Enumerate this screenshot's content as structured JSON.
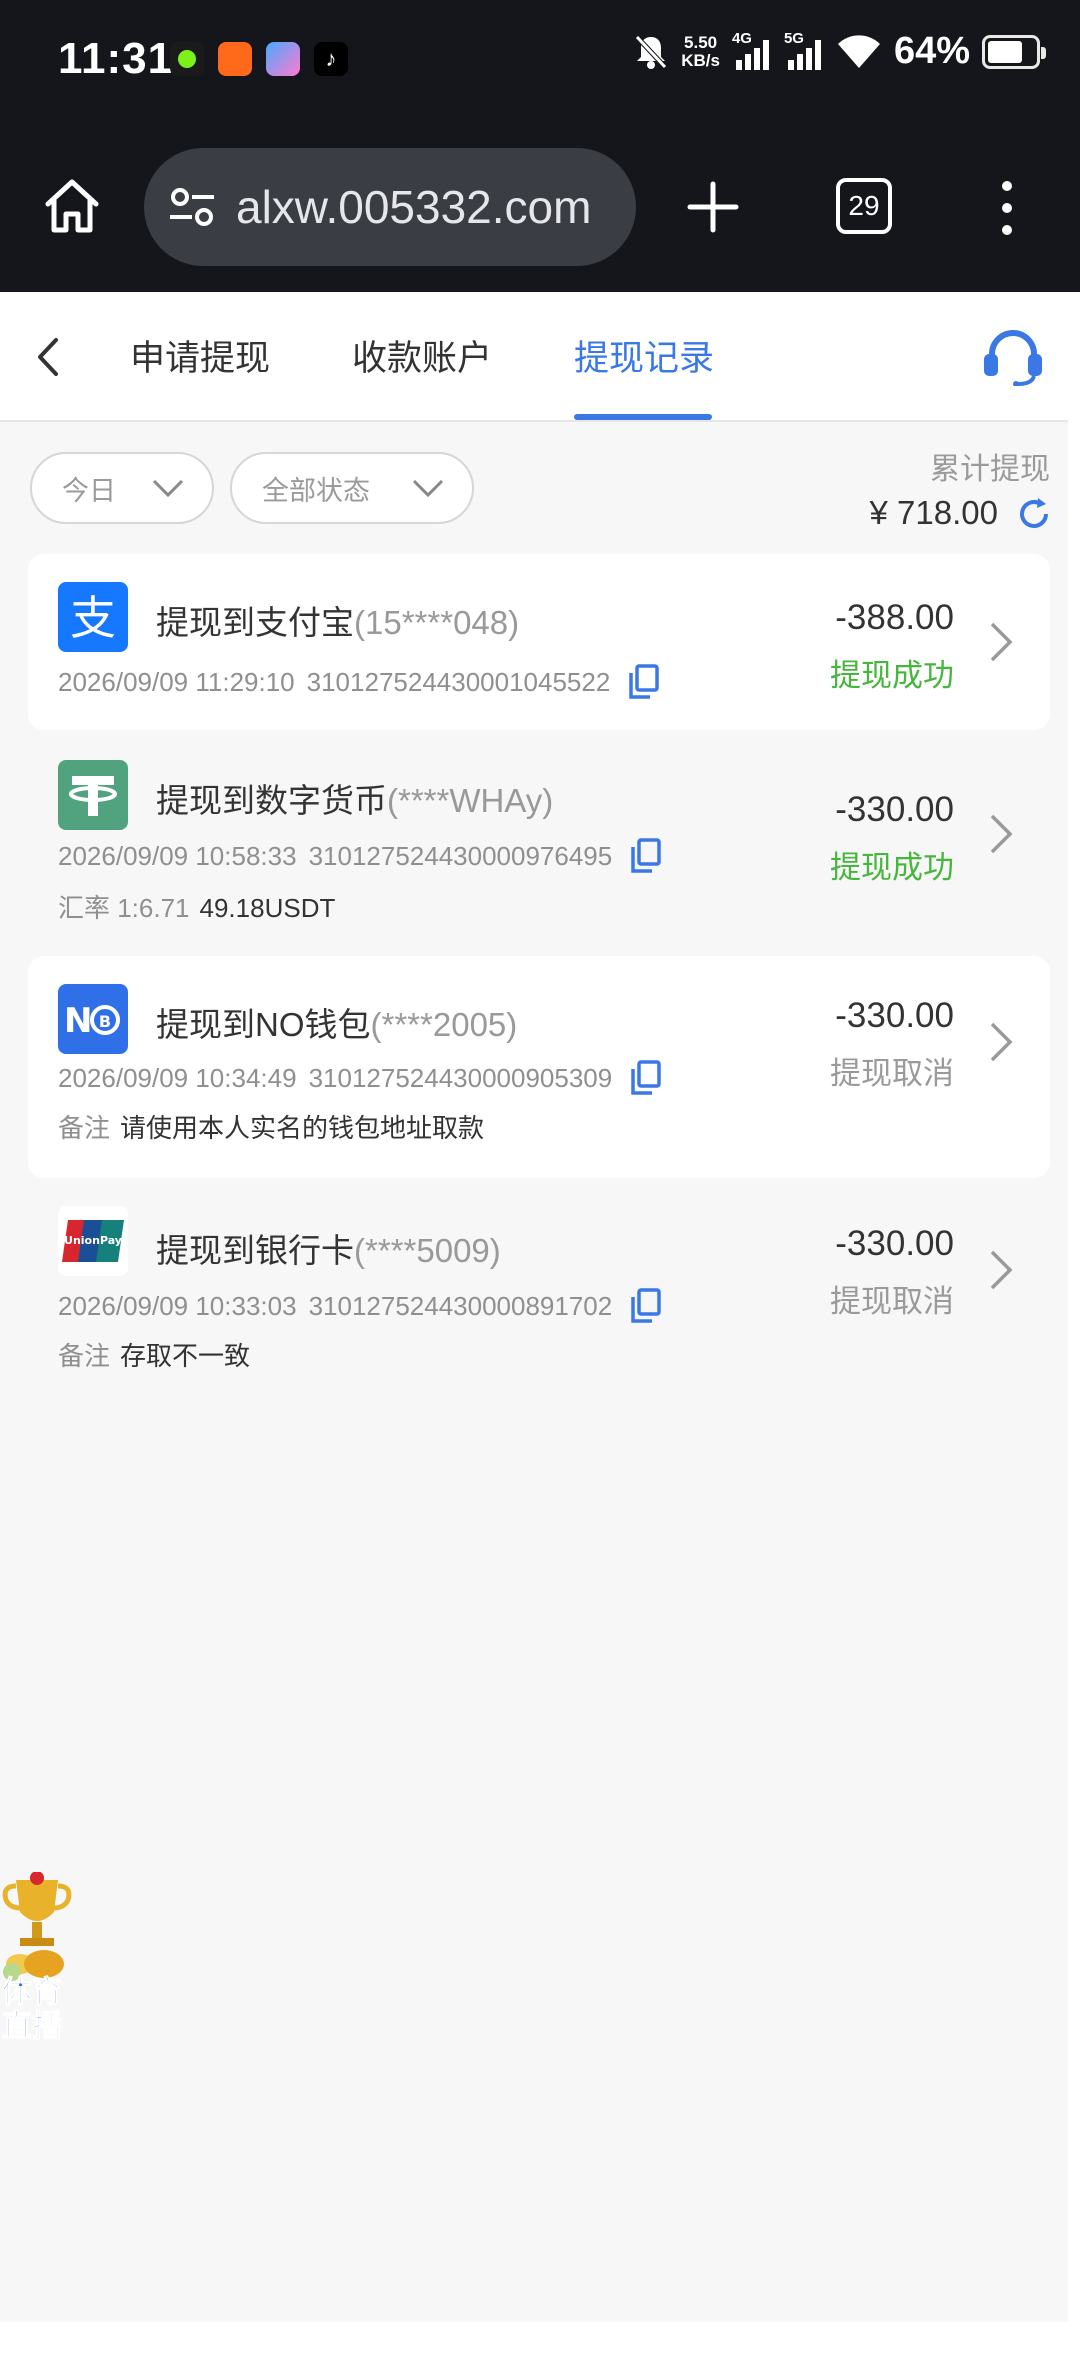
{
  "status_bar": {
    "time": "11:31",
    "net_speed_value": "5.50",
    "net_speed_unit": "KB/s",
    "net1": "4G",
    "net2": "5G",
    "battery": "64%"
  },
  "browser": {
    "url": "alxw.005332.com",
    "tab_count": "29"
  },
  "tabs": [
    "申请提现",
    "收款账户",
    "提现记录"
  ],
  "filters": {
    "date": "今日",
    "status": "全部状态"
  },
  "summary": {
    "label": "累计提现",
    "amount": "¥ 718.00"
  },
  "records": [
    {
      "title": "提现到支付宝",
      "account": "(15****048)",
      "datetime": "2026/09/09 11:29:10",
      "order_no": "310127524430001045522",
      "amount": "-388.00",
      "status": "提现成功",
      "icon": "alipay-icon"
    },
    {
      "title": "提现到数字货币",
      "account": "(****WHAy)",
      "datetime": "2026/09/09 10:58:33",
      "order_no": "310127524430000976495",
      "note_label": "汇率 1:6.71",
      "note_value": "49.18USDT",
      "amount": "-330.00",
      "status": "提现成功",
      "icon": "usdt-icon"
    },
    {
      "title": "提现到NO钱包",
      "account": "(****2005)",
      "datetime": "2026/09/09 10:34:49",
      "order_no": "310127524430000905309",
      "note_label": "备注",
      "note_value": "请使用本人实名的钱包地址取款",
      "amount": "-330.00",
      "status": "提现取消",
      "icon": "no-wallet-icon"
    },
    {
      "title": "提现到银行卡",
      "account": "(****5009)",
      "datetime": "2026/09/09 10:33:03",
      "order_no": "310127524430000891702",
      "note_label": "备注",
      "note_value": "存取不一致",
      "amount": "-330.00",
      "status": "提现取消",
      "icon": "unionpay-icon"
    }
  ],
  "float_badge": {
    "line1": "体育",
    "line2": "直播"
  },
  "colors": {
    "accent": "#3a78e6",
    "success": "#46b63c",
    "muted": "#9a9a9a"
  }
}
